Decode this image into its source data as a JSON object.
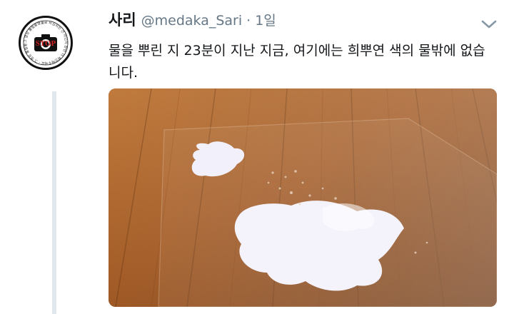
{
  "tweet": {
    "display_name": "사리",
    "handle": "@medaka_Sari",
    "separator": "·",
    "time": "1일",
    "text": "물을 뿌린 지 23분이 지난 지금, 여기에는 희뿌연 색의 물밖에 없습니다.",
    "avatar": {
      "icon": "camera-icon",
      "stamp_text": "STOP",
      "ring_text": "그 영상 불법촬영물로 의심되는 건 아닌지 한번 더 확인해주세요 · 그 영상 불법촬영물로 의심되는 건 아닌지 한번 더 확인해주세요"
    },
    "more_icon": "chevron-down-icon",
    "media": {
      "icon": "photo",
      "colors": {
        "wood": "#8a4a1c",
        "liquid": "#f3f2fb"
      }
    }
  }
}
